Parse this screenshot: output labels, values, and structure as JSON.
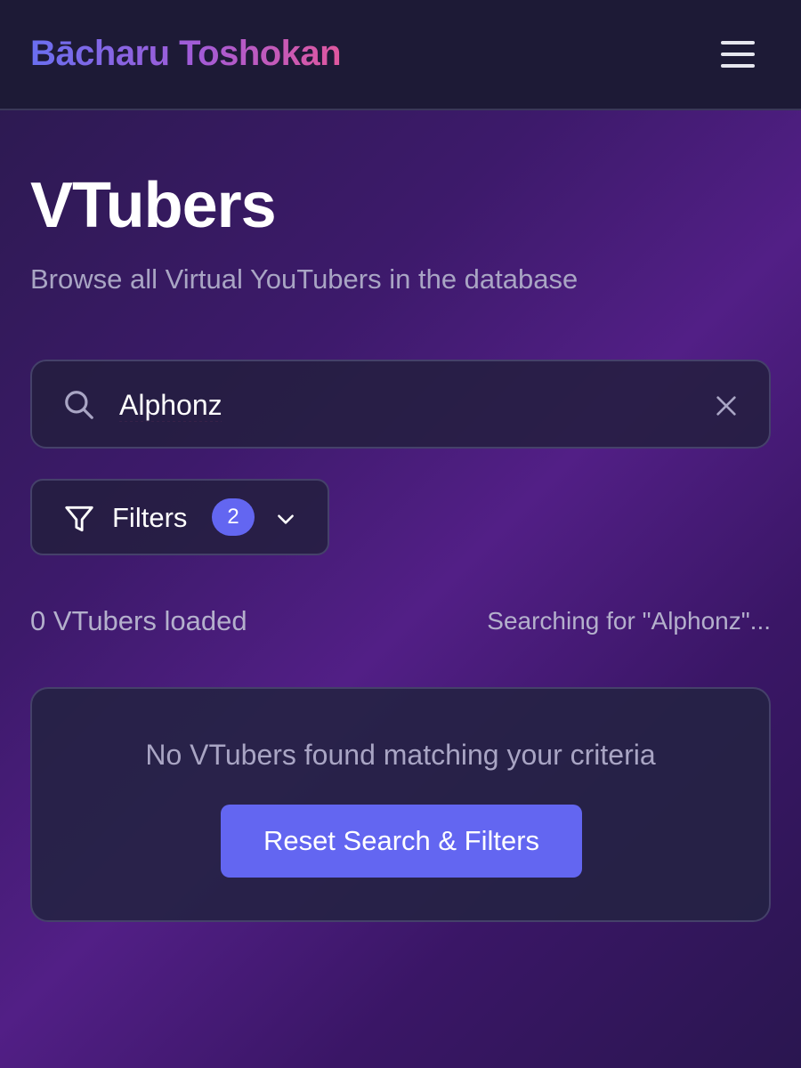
{
  "header": {
    "brand": "Bācharu Toshokan",
    "menu_icon": "hamburger-menu-icon"
  },
  "page": {
    "title": "VTubers",
    "subtitle": "Browse all Virtual YouTubers in the database"
  },
  "search": {
    "value": "Alphonz",
    "icon": "search-icon",
    "clear_icon": "close-icon"
  },
  "filters": {
    "label": "Filters",
    "active_count": "2",
    "icon": "filter-icon",
    "chevron": "chevron-down-icon"
  },
  "results": {
    "count_text": "0 VTubers loaded",
    "status_text": "Searching for \"Alphonz\"..."
  },
  "empty_state": {
    "message": "No VTubers found matching your criteria",
    "reset_label": "Reset Search & Filters"
  },
  "colors": {
    "accent": "#6366f1",
    "brand_gradient_start": "#6a6ff0",
    "brand_gradient_end": "#e0589f",
    "navbar_bg": "#1d1a36"
  }
}
